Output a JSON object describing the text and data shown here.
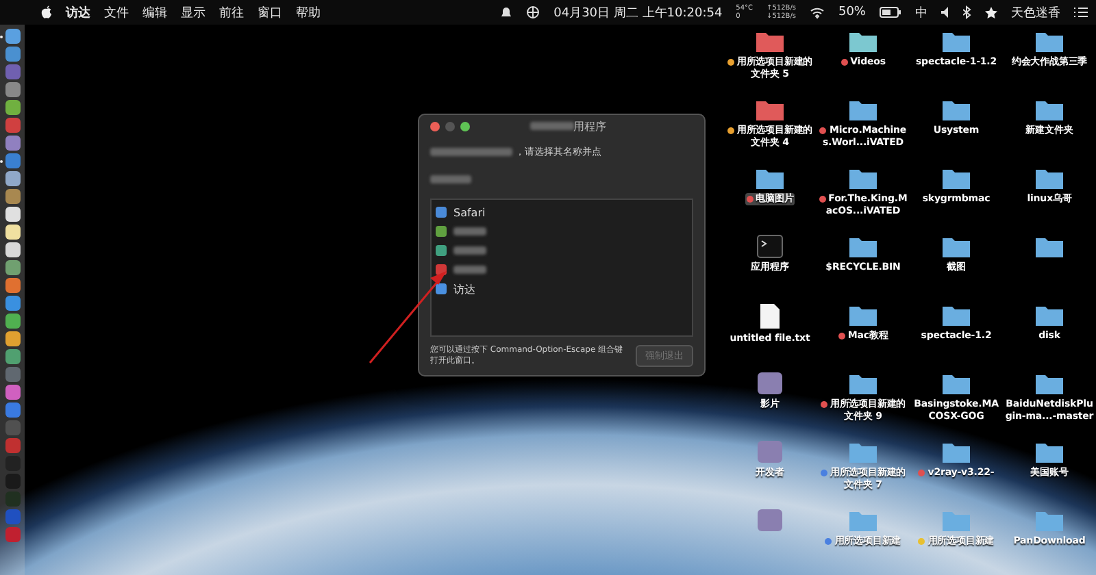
{
  "menu_bar": {
    "app": "访达",
    "menus": [
      "文件",
      "编辑",
      "显示",
      "前往",
      "窗口",
      "帮助"
    ],
    "clock": "04月30日 周二 上午10:20:54",
    "temp": "54°C",
    "temp_sub": "0",
    "net_up": "↑512B/s",
    "net_down": "↓512B/s",
    "battery": "50%",
    "input": "中",
    "user": "天色迷香"
  },
  "dock": [
    {
      "color": "#5aa0e0",
      "running": true
    },
    {
      "color": "#4a90d0",
      "running": false
    },
    {
      "color": "#7060b0",
      "running": false
    },
    {
      "color": "#888888",
      "running": false
    },
    {
      "color": "#70b040",
      "running": false
    },
    {
      "color": "#d04040",
      "running": false
    },
    {
      "color": "#9080c0",
      "running": false
    },
    {
      "color": "#3a80d0",
      "running": true
    },
    {
      "color": "#90a8c8",
      "running": false
    },
    {
      "color": "#a88850",
      "running": false
    },
    {
      "color": "#e0e0e0",
      "running": false
    },
    {
      "color": "#f0e0a0",
      "running": false
    },
    {
      "color": "#d8d8d8",
      "running": false
    },
    {
      "color": "#70a070",
      "running": false
    },
    {
      "color": "#e07030",
      "running": false
    },
    {
      "color": "#3a90e0",
      "running": false
    },
    {
      "color": "#50b050",
      "running": false
    },
    {
      "color": "#e0a030",
      "running": false
    },
    {
      "color": "#50a070",
      "running": false
    },
    {
      "color": "#606870",
      "running": false
    },
    {
      "color": "#d060c0",
      "running": false
    },
    {
      "color": "#3a7ae0",
      "running": false
    },
    {
      "color": "#505050",
      "running": false
    },
    {
      "color": "#c03030",
      "running": false
    },
    {
      "color": "#222222",
      "running": false
    },
    {
      "color": "#1a1a1a",
      "running": false
    },
    {
      "color": "#203020",
      "running": false
    },
    {
      "color": "#2050c0",
      "running": false
    },
    {
      "color": "#c02030",
      "running": false
    }
  ],
  "dialog": {
    "title": "用程序",
    "prompt": "，请选择其名称并点",
    "apps": [
      {
        "label": "Safari",
        "color": "#4a8ad8"
      },
      {
        "color": "#60a040"
      },
      {
        "color": "#40a080"
      },
      {
        "color": "#d03838"
      },
      {
        "label": "访达",
        "color": "#4a90e0"
      }
    ],
    "hint": "您可以通过按下 Command-Option-Escape 组合键打开此窗口。",
    "button": {
      "label": "强制退出",
      "disabled": true
    }
  },
  "desktop_items": [
    {
      "kind": "redfolder",
      "label": "用所选项目新建的文件夹 5",
      "color": "#e8a030"
    },
    {
      "kind": "tealfolder",
      "label": "Videos",
      "color": "#e05050"
    },
    {
      "kind": "folder",
      "label": "spectacle-1-1.2"
    },
    {
      "kind": "folder",
      "label": "约会大作战第三季"
    },
    {
      "kind": "redfolder",
      "label": "用所选项目新建的文件夹 4",
      "color": "#e8a030"
    },
    {
      "kind": "folder",
      "label": "Micro.Machines.Worl...iVATED",
      "color": "#e05050"
    },
    {
      "kind": "folder",
      "label": "Usystem"
    },
    {
      "kind": "folder",
      "label": "新建文件夹"
    },
    {
      "kind": "folder",
      "label": "电脑图片",
      "color": "#e05050",
      "selected": true
    },
    {
      "kind": "folder",
      "label": "For.The.King.MacOS...iVATED",
      "color": "#e05050"
    },
    {
      "kind": "folder",
      "label": "skygrmbmac"
    },
    {
      "kind": "folder",
      "label": "linux乌哥"
    },
    {
      "kind": "terminal",
      "label": "应用程序"
    },
    {
      "kind": "folder",
      "label": "$RECYCLE.BIN"
    },
    {
      "kind": "folder",
      "label": "截图"
    },
    {
      "kind": "folder"
    },
    {
      "kind": "document",
      "label": "untitled file.txt"
    },
    {
      "kind": "folder",
      "label": "Mac教程",
      "color": "#e05050"
    },
    {
      "kind": "folder",
      "label": "spectacle-1.2"
    },
    {
      "kind": "folder",
      "label": "disk"
    },
    {
      "kind": "image",
      "label": "影片"
    },
    {
      "kind": "folder",
      "label": "用所选项目新建的文件夹 9",
      "color": "#e05050"
    },
    {
      "kind": "folder",
      "label": "Basingstoke.MACOSX-GOG"
    },
    {
      "kind": "folder",
      "label": "BaiduNetdiskPlugin-ma...-master"
    },
    {
      "kind": "image",
      "label": "开发者"
    },
    {
      "kind": "folder",
      "label": "用所选项目新建的文件夹 7",
      "color": "#4a80e0"
    },
    {
      "kind": "folder",
      "label": "v2ray-v3.22-",
      "color": "#e05050"
    },
    {
      "kind": "folder",
      "label": "美国账号"
    },
    {
      "kind": "image"
    },
    {
      "kind": "folder",
      "label": "用所选项目新建",
      "color": "#4a80e0"
    },
    {
      "kind": "folder",
      "label": "用所选项目新建",
      "color": "#e8c030"
    },
    {
      "kind": "folder",
      "label": "PanDownload"
    }
  ]
}
